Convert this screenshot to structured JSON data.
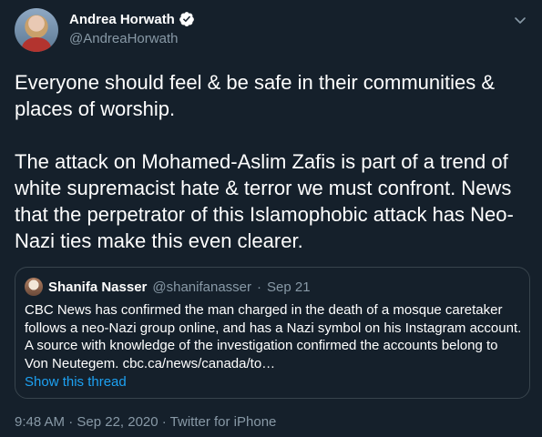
{
  "author": {
    "display_name": "Andrea Horwath",
    "handle": "@AndreaHorwath",
    "verified_icon": "verified-badge-icon"
  },
  "tweet": {
    "text": "Everyone should feel & be safe in their communities & places of worship.\n\nThe attack on Mohamed-Aslim Zafis is part of a trend of white supremacist hate & terror we must confront. News that the perpetrator of this Islamophobic attack has Neo-Nazi ties make this even clearer."
  },
  "quote": {
    "display_name": "Shanifa Nasser",
    "handle": "@shanifanasser",
    "separator": "·",
    "date": "Sep 21",
    "text": "CBC News has confirmed the man charged in the death of a mosque caretaker follows a neo-Nazi group online, and has a Nazi symbol on his Instagram account. A source with knowledge of the investigation confirmed the accounts belong to Von Neutegem. cbc.ca/news/canada/to…",
    "show_thread": "Show this thread"
  },
  "meta": {
    "text": "9:48 AM · Sep 22, 2020 · Twitter for iPhone"
  },
  "colors": {
    "background": "#15202b",
    "link": "#1da1f2",
    "secondary_text": "#8899a6",
    "border": "#38444d"
  }
}
